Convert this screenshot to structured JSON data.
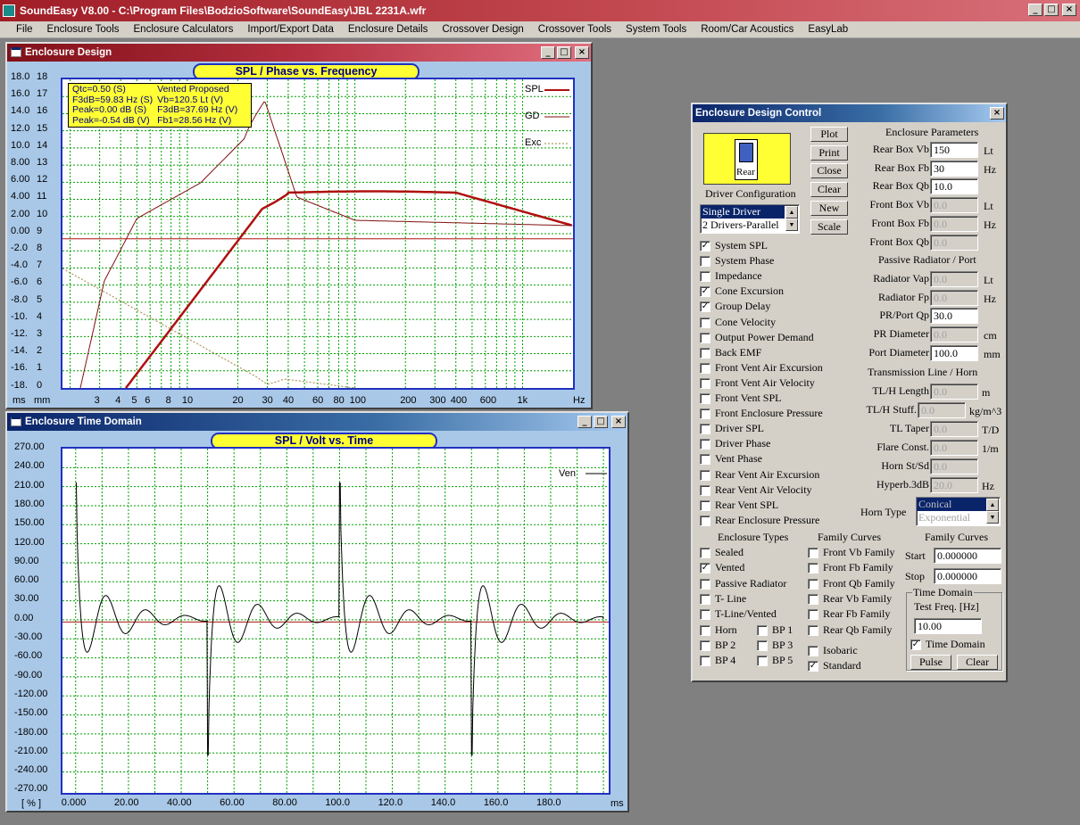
{
  "app": {
    "title": "SoundEasy V8.00 - C:\\Program Files\\BodzioSoftware\\SoundEasy\\JBL 2231A.wfr"
  },
  "menu": [
    "File",
    "Enclosure Tools",
    "Enclosure Calculators",
    "Import/Export Data",
    "Enclosure Details",
    "Crossover Design",
    "Crossover Tools",
    "System Tools",
    "Room/Car Acoustics",
    "EasyLab"
  ],
  "design_window": {
    "title": "Enclosure Design",
    "plot_title": "SPL / Phase vs. Frequency",
    "info": [
      [
        "Qtc=0.50 (S)",
        "Vented Proposed"
      ],
      [
        "F3dB=59.83 Hz (S)",
        "Vb=120.5 Lt (V)"
      ],
      [
        "Peak=0.00 dB (S)",
        "F3dB=37.69 Hz (V)"
      ],
      [
        "Peak=-0.54 dB (V)",
        "Fb1=28.56 Hz (V)"
      ]
    ],
    "legend": [
      "SPL",
      "GD",
      "Exc"
    ],
    "y_ms": [
      "18.0",
      "16.0",
      "14.0",
      "12.0",
      "10.0",
      "8.00",
      "6.00",
      "4.00",
      "2.00",
      "0.00",
      "-2.0",
      "-4.0",
      "-6.0",
      "-8.0",
      "-10.",
      "-12.",
      "-14.",
      "-16.",
      "-18."
    ],
    "y_mm": [
      "18",
      "17",
      "16",
      "15",
      "14",
      "13",
      "12",
      "11",
      "10",
      "9",
      "8",
      "7",
      "6",
      "5",
      "4",
      "3",
      "2",
      "1",
      "0"
    ],
    "x_labels": [
      "3",
      "4",
      "5",
      "6",
      "8",
      "10",
      "20",
      "30",
      "40",
      "60",
      "80",
      "100",
      "200",
      "300",
      "400",
      "600",
      "1k"
    ],
    "x_unit": "Hz",
    "y_unit_ms": "ms",
    "y_unit_mm": "mm"
  },
  "time_window": {
    "title": "Enclosure Time Domain",
    "plot_title": "SPL / Volt vs. Time",
    "legend": [
      "Ven"
    ],
    "y_labels": [
      "270.00",
      "240.00",
      "210.00",
      "180.00",
      "150.00",
      "120.00",
      "90.00",
      "60.00",
      "30.00",
      "0.00",
      "-30.00",
      "-60.00",
      "-90.00",
      "-120.00",
      "-150.00",
      "-180.00",
      "-210.00",
      "-240.00",
      "-270.00"
    ],
    "x_labels": [
      "0.000",
      "20.00",
      "40.00",
      "60.00",
      "80.00",
      "100.0",
      "120.0",
      "140.0",
      "160.0",
      "180.0"
    ],
    "x_unit": "ms",
    "y_unit": "[ % ]"
  },
  "control": {
    "title": "Enclosure Design Control",
    "rear_icon_label": "Rear",
    "buttons": [
      "Plot",
      "Print",
      "Close",
      "Clear",
      "New",
      "Scale"
    ],
    "driver_config_label": "Driver Configuration",
    "driver_options": [
      "Single Driver",
      "2 Drivers-Parallel"
    ],
    "plot_checks": [
      {
        "label": "System SPL",
        "checked": true
      },
      {
        "label": "System Phase",
        "checked": false
      },
      {
        "label": "Impedance",
        "checked": false
      },
      {
        "label": "Cone Excursion",
        "checked": true
      },
      {
        "label": "Group Delay",
        "checked": true
      },
      {
        "label": "Cone Velocity",
        "checked": false
      },
      {
        "label": "Output Power Demand",
        "checked": false
      },
      {
        "label": "Back EMF",
        "checked": false
      },
      {
        "label": "Front Vent Air Excursion",
        "checked": false
      },
      {
        "label": "Front Vent Air Velocity",
        "checked": false
      },
      {
        "label": "Front Vent SPL",
        "checked": false
      },
      {
        "label": "Front Enclosure Pressure",
        "checked": false
      },
      {
        "label": "Driver SPL",
        "checked": false
      },
      {
        "label": "Driver Phase",
        "checked": false
      },
      {
        "label": "Vent Phase",
        "checked": false
      },
      {
        "label": "Rear Vent Air Excursion",
        "checked": false
      },
      {
        "label": "Rear Vent Air Velocity",
        "checked": false
      },
      {
        "label": "Rear Vent SPL",
        "checked": false
      },
      {
        "label": "Rear Enclosure Pressure",
        "checked": false
      }
    ],
    "enclosure_params_title": "Enclosure Parameters",
    "params": [
      {
        "label": "Rear Box Vb",
        "value": "150",
        "unit": "Lt",
        "enabled": true
      },
      {
        "label": "Rear Box Fb",
        "value": "30",
        "unit": "Hz",
        "enabled": true
      },
      {
        "label": "Rear Box Qb",
        "value": "10.0",
        "unit": "",
        "enabled": true
      },
      {
        "label": "Front Box Vb",
        "value": "0.0",
        "unit": "Lt",
        "enabled": false
      },
      {
        "label": "Front Box Fb",
        "value": "0.0",
        "unit": "Hz",
        "enabled": false
      },
      {
        "label": "Front Box Qb",
        "value": "0.0",
        "unit": "",
        "enabled": false
      }
    ],
    "pr_title": "Passive Radiator / Port",
    "pr_params": [
      {
        "label": "Radiator Vap",
        "value": "0.0",
        "unit": "Lt",
        "enabled": false
      },
      {
        "label": "Radiator Fp",
        "value": "0.0",
        "unit": "Hz",
        "enabled": false
      },
      {
        "label": "PR/Port Qp",
        "value": "30.0",
        "unit": "",
        "enabled": true
      },
      {
        "label": "PR Diameter",
        "value": "0.0",
        "unit": "cm",
        "enabled": false
      },
      {
        "label": "Port Diameter",
        "value": "100.0",
        "unit": "mm",
        "enabled": true
      }
    ],
    "tl_title": "Transmission Line / Horn",
    "tl_params": [
      {
        "label": "TL/H Length",
        "value": "0.0",
        "unit": "m",
        "enabled": false
      },
      {
        "label": "TL/H Stuff.",
        "value": "0.0",
        "unit": "kg/m^3",
        "enabled": false
      },
      {
        "label": "TL Taper",
        "value": "0.0",
        "unit": "T/D",
        "enabled": false
      },
      {
        "label": "Flare Const.",
        "value": "0.0",
        "unit": "1/m",
        "enabled": false
      },
      {
        "label": "Horn St/Sd",
        "value": "0.0",
        "unit": "",
        "enabled": false
      },
      {
        "label": "Hyperb.3dB",
        "value": "20.0",
        "unit": "Hz",
        "enabled": false
      }
    ],
    "horn_type_label": "Horn Type",
    "horn_options": [
      "Conical",
      "Exponential"
    ],
    "enclosure_types_title": "Enclosure Types",
    "enclosure_types": [
      {
        "label": "Sealed",
        "checked": false
      },
      {
        "label": "Vented",
        "checked": true
      },
      {
        "label": "Passive Radiator",
        "checked": false
      },
      {
        "label": "T- Line",
        "checked": false
      },
      {
        "label": "T-Line/Vented",
        "checked": false
      }
    ],
    "bp_types": [
      {
        "label": "Horn",
        "checked": false
      },
      {
        "label": "BP 1",
        "checked": false
      },
      {
        "label": "BP 2",
        "checked": false
      },
      {
        "label": "BP 3",
        "checked": false
      },
      {
        "label": "BP 4",
        "checked": false
      },
      {
        "label": "BP 5",
        "checked": false
      }
    ],
    "family_title": "Family Curves",
    "family_checks": [
      {
        "label": "Front Vb Family",
        "checked": false
      },
      {
        "label": "Front Fb Family",
        "checked": false
      },
      {
        "label": "Front Qb Family",
        "checked": false
      },
      {
        "label": "Rear Vb Family",
        "checked": false
      },
      {
        "label": "Rear Fb Family",
        "checked": false
      },
      {
        "label": "Rear Qb Family",
        "checked": false
      }
    ],
    "isobaric": {
      "label": "Isobaric",
      "checked": false
    },
    "standard": {
      "label": "Standard",
      "checked": true
    },
    "family2_title": "Family Curves",
    "start_label": "Start",
    "start_value": "0.000000",
    "stop_label": "Stop",
    "stop_value": "0.000000",
    "td_group_title": "Time Domain",
    "test_freq_label": "Test Freq. [Hz]",
    "test_freq_value": "10.00",
    "td_check": {
      "label": "Time Domain",
      "checked": true
    },
    "pulse_button": "Pulse",
    "clear_button": "Clear"
  },
  "colors": {
    "spl_curve": "#b01010",
    "gd_curve": "#801010",
    "exc_curve": "#a08040",
    "grid": "#00a000",
    "plot_border": "#2030c0",
    "plot_bg": "#a9c8e8"
  }
}
